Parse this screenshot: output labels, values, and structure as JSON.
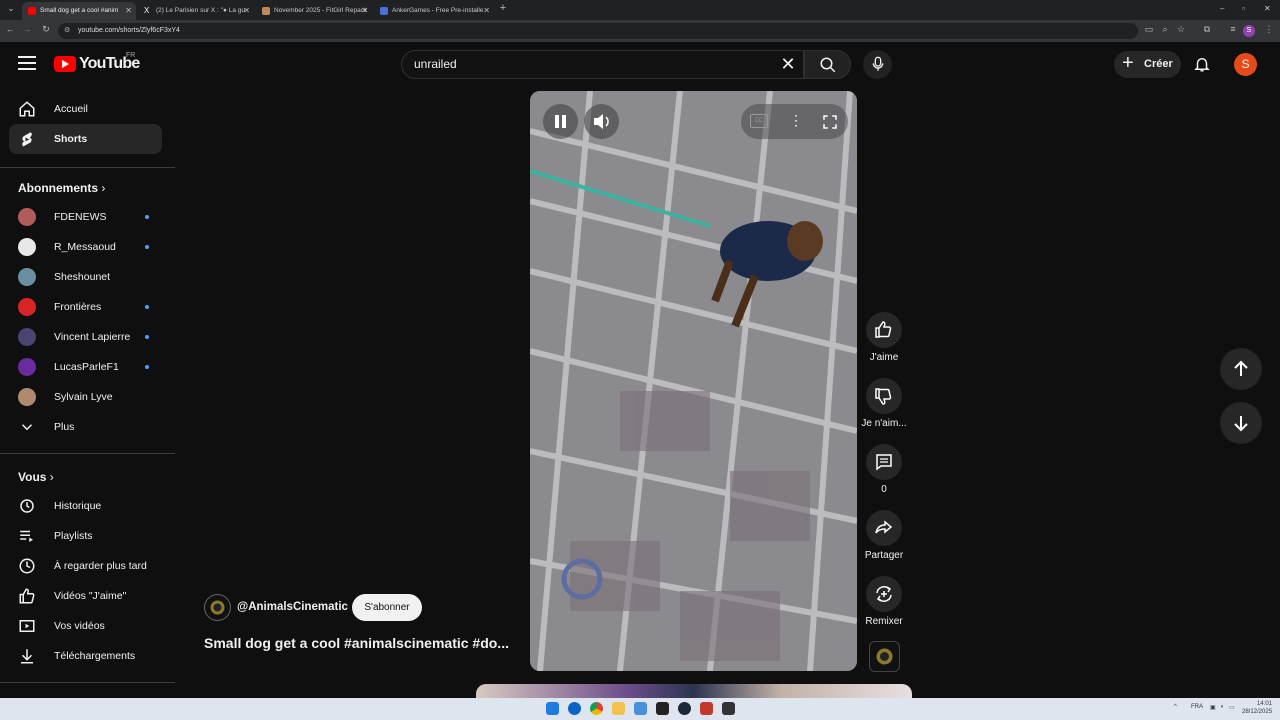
{
  "browser": {
    "tabs": [
      {
        "label": "Small dog get a cool #anim",
        "active": true,
        "color": "#ff0000"
      },
      {
        "label": "(2) Le Parisien sur X : \"● La gu",
        "active": false,
        "color": "#ffffff"
      },
      {
        "label": "November 2025 - FitGirl Repack",
        "active": false,
        "color": "#c08a5a"
      },
      {
        "label": "AnkerGames - Free Pre-installe",
        "active": false,
        "color": "#4a6fd8"
      }
    ],
    "url": "youtube.com/shorts/Zlyf6cF3xY4",
    "profile_initial": "S"
  },
  "header": {
    "logo_text": "YouTube",
    "logo_region": "FR",
    "search_value": "unrailed",
    "create_label": "Créer",
    "avatar_initial": "S"
  },
  "sidebar": {
    "main": [
      {
        "label": "Accueil",
        "icon": "home-icon",
        "active": false
      },
      {
        "label": "Shorts",
        "icon": "shorts-icon",
        "active": true
      }
    ],
    "subscriptions_title": "Abonnements",
    "subscriptions": [
      {
        "label": "FDENEWS",
        "color": "#b35b5b",
        "dot": true
      },
      {
        "label": "R_Messaoud",
        "color": "#e8e8e8",
        "dot": true
      },
      {
        "label": "Sheshounet",
        "color": "#6a8fa0",
        "dot": false
      },
      {
        "label": "Frontières",
        "color": "#d92525",
        "dot": true
      },
      {
        "label": "Vincent Lapierre",
        "color": "#4a4470",
        "dot": true
      },
      {
        "label": "LucasParleF1",
        "color": "#6a2aa0",
        "dot": true
      },
      {
        "label": "Sylvain Lyve",
        "color": "#b08a70",
        "dot": false
      }
    ],
    "more_label": "Plus",
    "you_title": "Vous",
    "you_items": [
      {
        "label": "Historique",
        "icon": "history-icon"
      },
      {
        "label": "Playlists",
        "icon": "playlist-icon"
      },
      {
        "label": "À regarder plus tard",
        "icon": "watch-later-icon"
      },
      {
        "label": "Vidéos \"J'aime\"",
        "icon": "like-icon"
      },
      {
        "label": "Vos vidéos",
        "icon": "your-videos-icon"
      },
      {
        "label": "Téléchargements",
        "icon": "download-icon"
      }
    ]
  },
  "short": {
    "channel": "@AnimalsCinematic",
    "subscribe_label": "S'abonner",
    "title": "Small dog get a cool #animalscinematic #do...",
    "cc_label": "CC"
  },
  "actions": {
    "like": "J'aime",
    "dislike": "Je n'aim...",
    "comments": "0",
    "share": "Partager",
    "remix": "Remixer"
  },
  "taskbar": {
    "lang": "FRA",
    "time": "14:01",
    "date": "28/12/2025"
  }
}
